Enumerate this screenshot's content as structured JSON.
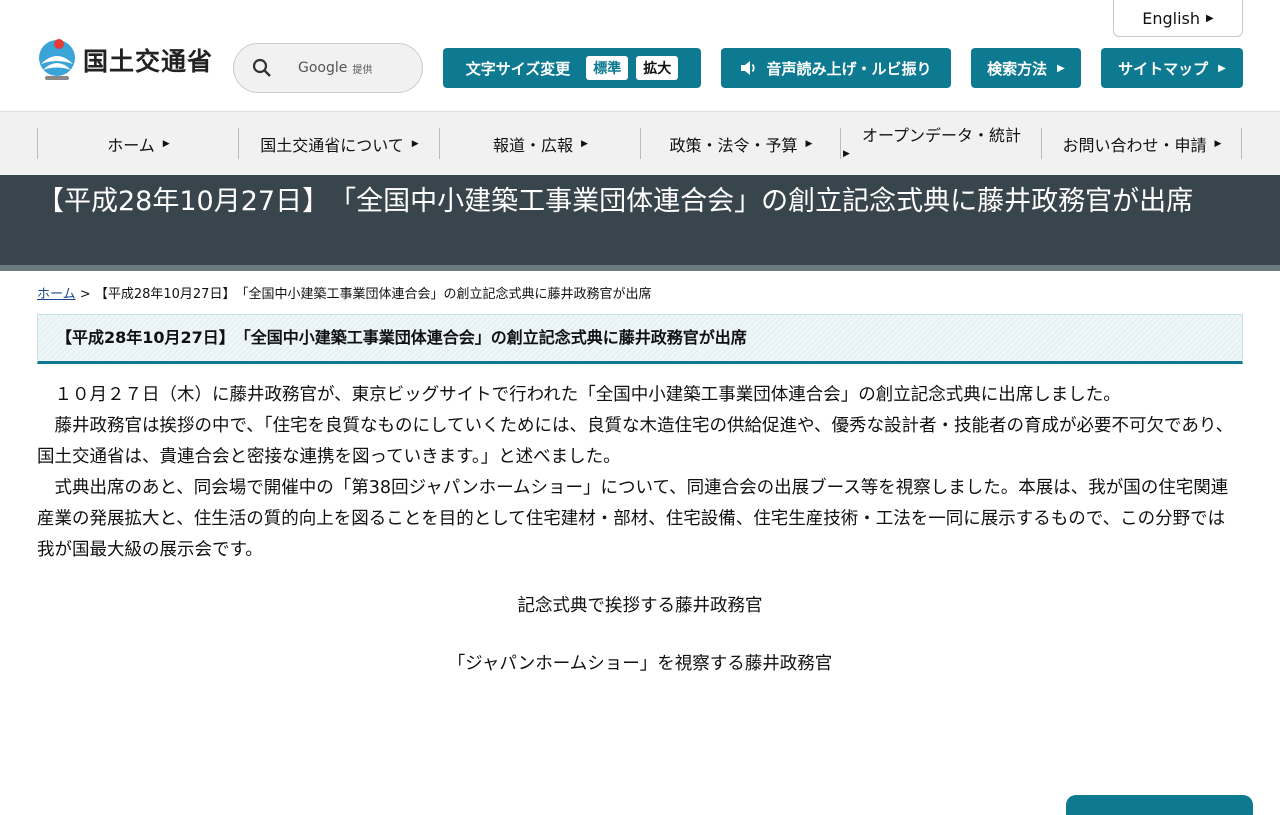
{
  "header": {
    "logo_text": "国土交通省",
    "english_label": "English",
    "search": {
      "google_label": "Google",
      "provided_label": "提供"
    },
    "font_size": {
      "label": "文字サイズ変更",
      "standard": "標準",
      "enlarge": "拡大"
    },
    "voice_label": "音声読み上げ・ルビ振り",
    "search_method_label": "検索方法",
    "sitemap_label": "サイトマップ"
  },
  "nav": {
    "items": [
      {
        "label": "ホーム"
      },
      {
        "label": "国土交通省について"
      },
      {
        "label": "報道・広報"
      },
      {
        "label": "政策・法令・予算"
      },
      {
        "label": "オープンデータ・統計"
      },
      {
        "label": "お問い合わせ・申請"
      }
    ]
  },
  "page": {
    "title": "【平成28年10月27日】　「全国中小建築工事業団体連合会」の創立記念式典に藤井政務官が出席",
    "breadcrumb": {
      "home": "ホーム",
      "separator": ">",
      "current": "【平成28年10月27日】　「全国中小建築工事業団体連合会」の創立記念式典に藤井政務官が出席"
    },
    "subtitle": "【平成28年10月27日】　「全国中小建築工事業団体連合会」の創立記念式典に藤井政務官が出席",
    "paragraphs": [
      "１０月２７日（木）に藤井政務官が、東京ビッグサイトで行われた「全国中小建築工事業団体連合会」の創立記念式典に出席しました。",
      "藤井政務官は挨拶の中で、「住宅を良質なものにしていくためには、良質な木造住宅の供給促進や、優秀な設計者・技能者の育成が必要不可欠であり、国土交通省は、貴連合会と密接な連携を図っていきます。」と述べました。",
      "式典出席のあと、同会場で開催中の「第38回ジャパンホームショー」について、同連合会の出展ブース等を視察しました。本展は、我が国の住宅関連産業の発展拡大と、住生活の質的向上を図ることを目的として住宅建材・部材、住宅設備、住宅生産技術・工法を一同に展示するもので、この分野では我が国最大級の展示会です。"
    ],
    "caption1": "記念式典で挨拶する藤井政務官",
    "caption2": "「ジャパンホームショー」を視察する藤井政務官"
  },
  "colors": {
    "accent": "#0e7a91",
    "title_band": "#39454c",
    "nav_bg": "#f1f1f1"
  }
}
